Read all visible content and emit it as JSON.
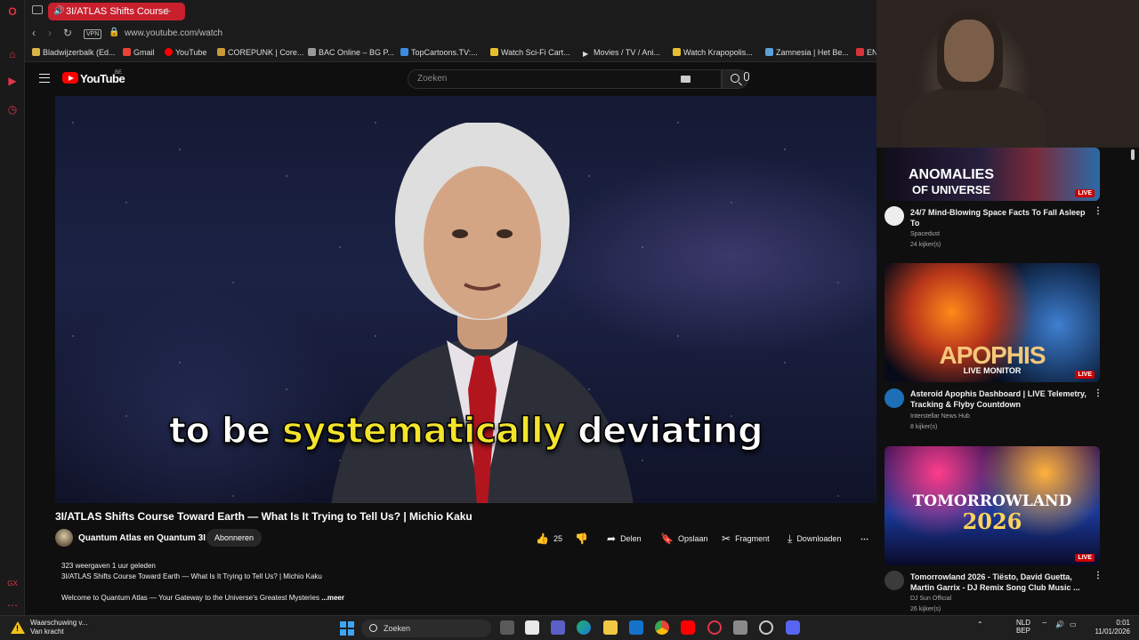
{
  "browser": {
    "tab_title": "3I/ATLAS Shifts Course",
    "url": "www.youtube.com/watch",
    "vpn_label": "VPN",
    "bookmarks": [
      {
        "label": "Bladwijzerbalk (Ed...",
        "icon": "folder-icon"
      },
      {
        "label": "Gmail",
        "icon": "gmail-icon"
      },
      {
        "label": "YouTube",
        "icon": "youtube-icon"
      },
      {
        "label": "COREPUNK | Core...",
        "icon": "corepunk-icon"
      },
      {
        "label": "BAC Online – BG P...",
        "icon": "bac-icon"
      },
      {
        "label": "TopCartoons.TV:...",
        "icon": "topcartoons-icon"
      },
      {
        "label": "Watch Sci-Fi Cart...",
        "icon": "scifi-icon"
      },
      {
        "label": "Movies / TV / Ani...",
        "icon": "play-icon"
      },
      {
        "label": "Watch Krapopolis...",
        "icon": "krapopolis-icon"
      },
      {
        "label": "Zamnesia | Het Be...",
        "icon": "zamnesia-icon"
      },
      {
        "label": "EN",
        "icon": "en-icon"
      }
    ]
  },
  "header": {
    "logo_text": "YouTube",
    "country": "BE",
    "search_placeholder": "Zoeken"
  },
  "video": {
    "caption_before": "to be ",
    "caption_highlight": "systematically",
    "caption_after": " deviating",
    "title": "3I/ATLAS Shifts Course Toward Earth — What Is It Trying to Tell Us? | Michio Kaku",
    "channel": "Quantum Atlas en Quantum 3I",
    "subscribe": "Abonneren",
    "likes": "25",
    "share": "Delen",
    "save": "Opslaan",
    "clip": "Fragment",
    "download": "Downloaden",
    "views": "323 weergaven  1 uur geleden",
    "desc_line1": "3I/ATLAS Shifts Course Toward Earth — What Is It Trying to Tell Us? | Michio Kaku",
    "desc_line2": "Welcome to Quantum Atlas — Your Gateway to the Universe's Greatest Mysteries",
    "more": "...meer"
  },
  "sidebar": [
    {
      "thumb_line1": "ANOMALIES",
      "thumb_line2": "OF UNIVERSE",
      "title": "24/7 Mind-Blowing Space Facts To Fall Asleep To",
      "channel": "Spacedust",
      "viewers": "24 kijker(s)",
      "live": "LIVE"
    },
    {
      "thumb_line1": "APOPHIS",
      "thumb_line2": "LIVE MONITOR",
      "title": "Asteroid Apophis Dashboard | LIVE Telemetry, Tracking & Flyby Countdown",
      "channel": "Interstellar News Hub",
      "viewers": "8 kijker(s)",
      "live": "LIVE"
    },
    {
      "thumb_line1": "TOMORROWLAND",
      "thumb_line2": "2026",
      "title": "Tomorrowland 2026 - Tiësto, David Guetta, Martin Garrix - DJ Remix Song Club Music ...",
      "channel": "DJ Sun Official",
      "viewers": "26 kijker(s)",
      "live": "LIVE"
    }
  ],
  "taskbar": {
    "warning_title": "Waarschuwing v...",
    "warning_sub": "Van kracht",
    "search": "Zoeken",
    "lang1": "NLD",
    "lang2": "BEP",
    "time": "0:01",
    "date": "11/01/2026"
  }
}
